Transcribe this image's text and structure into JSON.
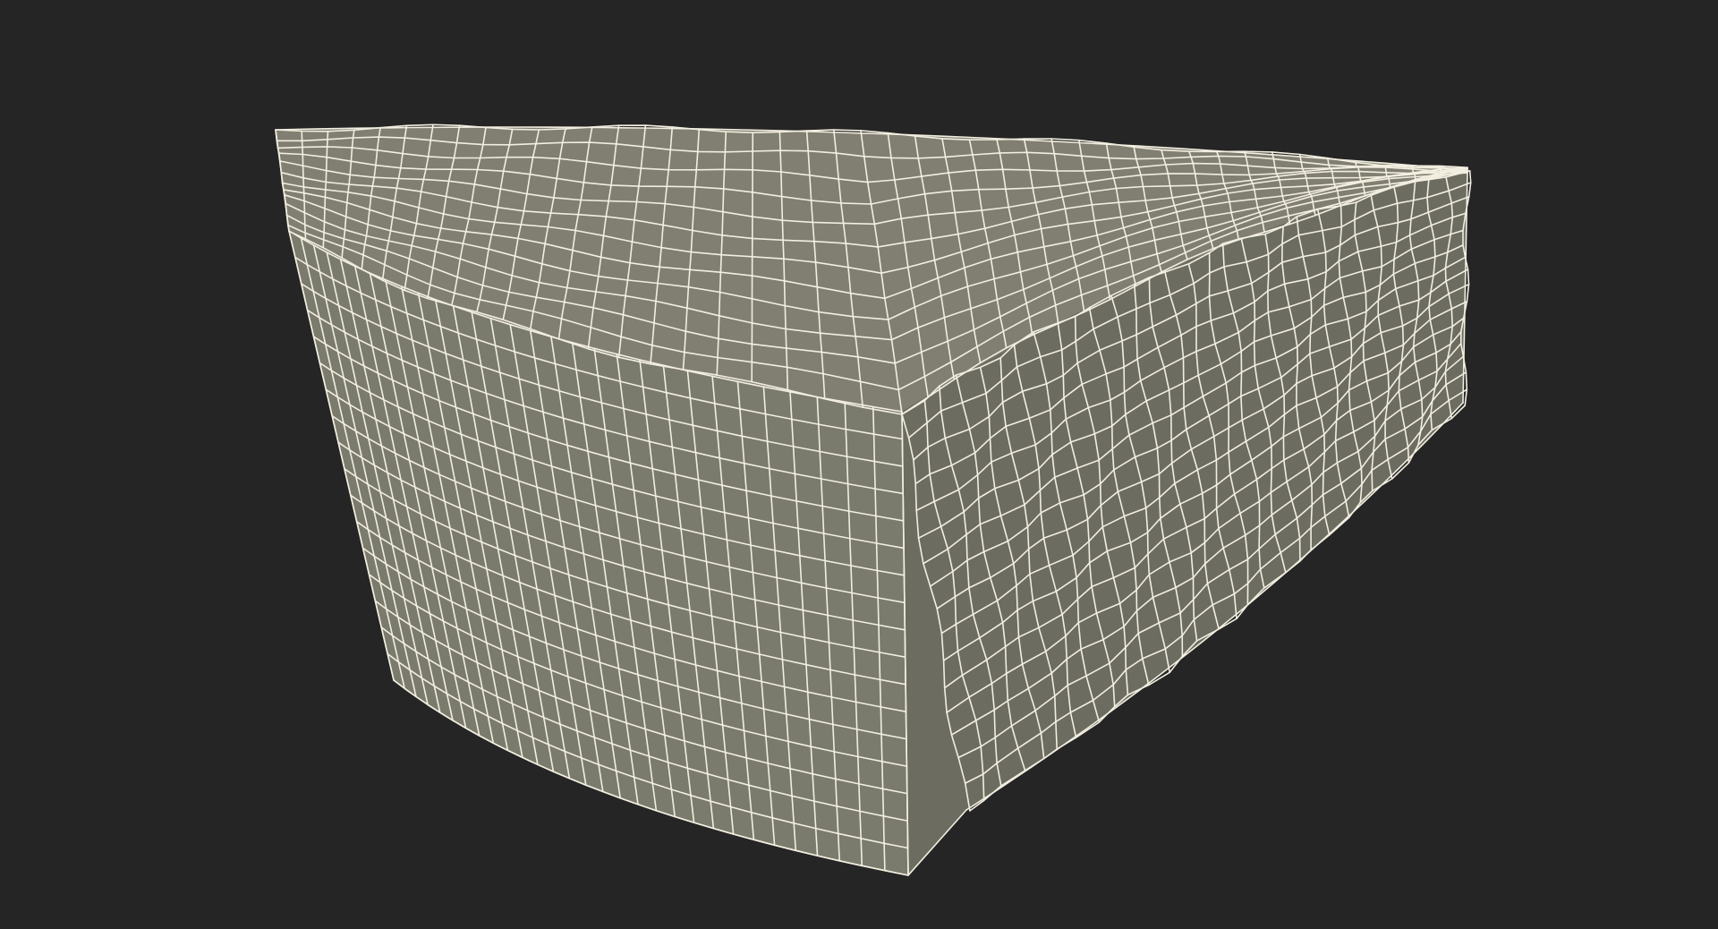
{
  "viewport": {
    "background_color": "#252525"
  },
  "model": {
    "subject": "cheese-wedge-wireframe",
    "surface_color": "#7a7a6d",
    "top_surface_color": "#807f72",
    "shadow_color": "#6d6c61",
    "wire_color": "#f2eee0"
  }
}
